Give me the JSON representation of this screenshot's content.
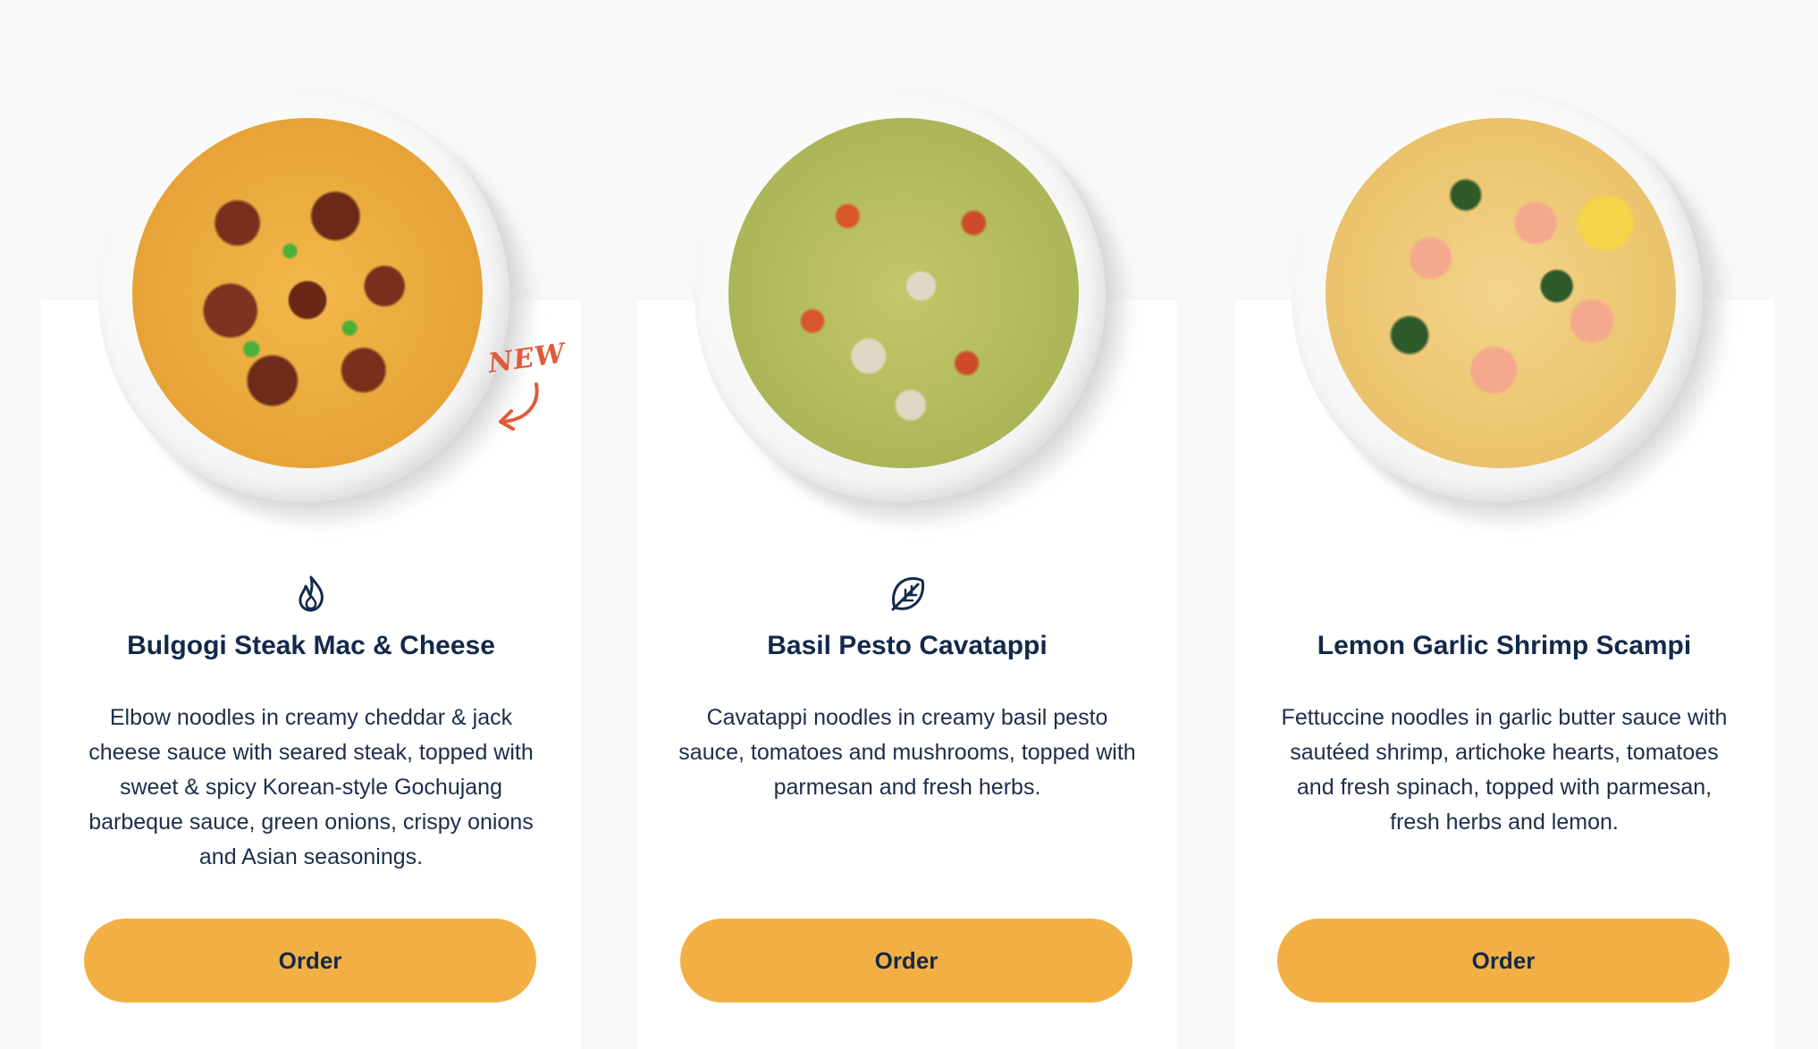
{
  "badge": {
    "label": "NEW",
    "color": "#e05a3a"
  },
  "accent_color": "#f2b044",
  "title_color": "#13294b",
  "cards": [
    {
      "title": "Bulgogi Steak Mac & Cheese",
      "icon": "flame-icon",
      "description": "Elbow noodles in creamy cheddar & jack cheese sauce with seared steak, topped with sweet & spicy Korean-style Gochujang barbeque sauce, green onions, crispy onions and Asian seasonings.",
      "button_label": "Order"
    },
    {
      "title": "Basil Pesto Cavatappi",
      "icon": "leaf-icon",
      "description": "Cavatappi noodles in creamy basil pesto sauce, tomatoes and mushrooms, topped with parmesan and fresh herbs.",
      "button_label": "Order"
    },
    {
      "title": "Lemon Garlic Shrimp Scampi",
      "icon": "",
      "description": "Fettuccine noodles in garlic butter sauce with sautéed shrimp, artichoke hearts, tomatoes and fresh spinach, topped with parmesan, fresh herbs and lemon.",
      "button_label": "Order"
    }
  ]
}
